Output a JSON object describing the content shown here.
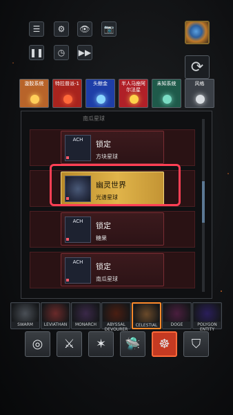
{
  "toolbar": {
    "menu_icon": "menu-icon",
    "settings_icon": "gear-icon",
    "eye_icon": "eye-icon",
    "camera_icon": "camera-icon",
    "pause_icon": "pause-icon",
    "speed_icon": "clock-icon",
    "fast_forward_icon": "fast-forward-icon",
    "planet_icon": "planet-icon",
    "refresh_icon": "refresh-icon"
  },
  "galaxy_tabs": [
    {
      "label": "漩胶系统",
      "color": "#b8642a",
      "glow": "#ffcf5a"
    },
    {
      "label": "特拉普派-1",
      "color": "#a8241e",
      "glow": "#ff6a3a"
    },
    {
      "label": "头鲸金",
      "color": "#1e3ea8",
      "glow": "#8ad6ff"
    },
    {
      "label": "半人马座阿尔法星",
      "color": "#b02028",
      "glow": "#ffd24a"
    },
    {
      "label": "未知系统",
      "color": "#1f5a4a",
      "glow": "#7adcc4"
    },
    {
      "label": "风格",
      "color": "#3a3f46",
      "glow": "#d9dde1"
    }
  ],
  "list": {
    "faded_row_text": "南瓜星球",
    "rows": [
      {
        "thumb_label": "ACH",
        "name": "锁定",
        "sub": "方块星球",
        "active": false
      },
      {
        "thumb_label": "",
        "name": "幽灵世界",
        "sub": "光谱星球",
        "active": true
      },
      {
        "thumb_label": "ACH",
        "name": "锁定",
        "sub": "糖果",
        "active": false
      },
      {
        "thumb_label": "ACH",
        "name": "锁定",
        "sub": "南瓜星球",
        "active": false
      }
    ]
  },
  "monsters": [
    {
      "label": "SWARM",
      "color": "#4a4f56"
    },
    {
      "label": "LEVIATHAN",
      "color": "#6a2a2a"
    },
    {
      "label": "MONARCH",
      "color": "#3a2848"
    },
    {
      "label": "ABYSSAL DEVOURER",
      "color": "#4a1e12"
    },
    {
      "label": "CELESTIAL",
      "color": "#6a4a2a"
    },
    {
      "label": "DOGE",
      "color": "#4a1e3e"
    },
    {
      "label": "POLYGON ENTITY",
      "color": "#2a1e5a"
    }
  ],
  "tools": [
    {
      "icon": "vortex-icon",
      "glyph": "◎"
    },
    {
      "icon": "sword-icon",
      "glyph": "⚔"
    },
    {
      "icon": "blast-icon",
      "glyph": "✶"
    },
    {
      "icon": "ufo-icon",
      "glyph": "🛸"
    },
    {
      "icon": "tentacle-monster-icon",
      "glyph": "☸"
    },
    {
      "icon": "shield-icon",
      "glyph": "⛉"
    }
  ]
}
